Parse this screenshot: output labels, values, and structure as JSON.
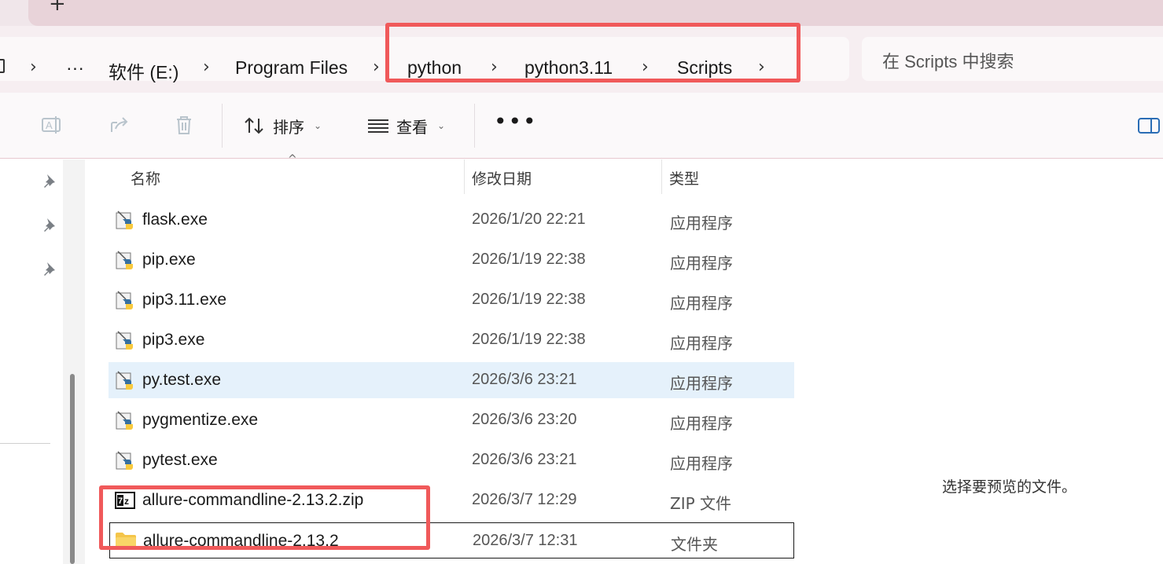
{
  "tabbar": {
    "new_tab_label": "+"
  },
  "breadcrumb": {
    "overflow_label": "···",
    "items": [
      "软件 (E:)",
      "Program Files",
      "python",
      "python3.11",
      "Scripts"
    ]
  },
  "search": {
    "placeholder": "在 Scripts 中搜索"
  },
  "toolbar": {
    "sort_label": "排序",
    "view_label": "查看",
    "more_label": "•••"
  },
  "columns": {
    "name": "名称",
    "date": "修改日期",
    "type": "类型"
  },
  "files": [
    {
      "name": "flask.exe",
      "date": "2026/1/20 22:21",
      "type": "应用程序",
      "icon": "python-exe-icon"
    },
    {
      "name": "pip.exe",
      "date": "2026/1/19 22:38",
      "type": "应用程序",
      "icon": "python-exe-icon"
    },
    {
      "name": "pip3.11.exe",
      "date": "2026/1/19 22:38",
      "type": "应用程序",
      "icon": "python-exe-icon"
    },
    {
      "name": "pip3.exe",
      "date": "2026/1/19 22:38",
      "type": "应用程序",
      "icon": "python-exe-icon"
    },
    {
      "name": "py.test.exe",
      "date": "2026/3/6 23:21",
      "type": "应用程序",
      "icon": "python-exe-icon"
    },
    {
      "name": "pygmentize.exe",
      "date": "2026/3/6 23:20",
      "type": "应用程序",
      "icon": "python-exe-icon"
    },
    {
      "name": "pytest.exe",
      "date": "2026/3/6 23:21",
      "type": "应用程序",
      "icon": "python-exe-icon"
    },
    {
      "name": "allure-commandline-2.13.2.zip",
      "date": "2026/3/7 12:29",
      "type": "ZIP 文件",
      "icon": "7zip-archive-icon"
    },
    {
      "name": "allure-commandline-2.13.2",
      "date": "2026/3/7 12:31",
      "type": "文件夹",
      "icon": "folder-icon"
    }
  ],
  "preview": {
    "empty_message": "选择要预览的文件。"
  },
  "colors": {
    "highlight": "#f0595a",
    "selected_row": "#e5f1fb",
    "accent": "#2a6db5"
  }
}
